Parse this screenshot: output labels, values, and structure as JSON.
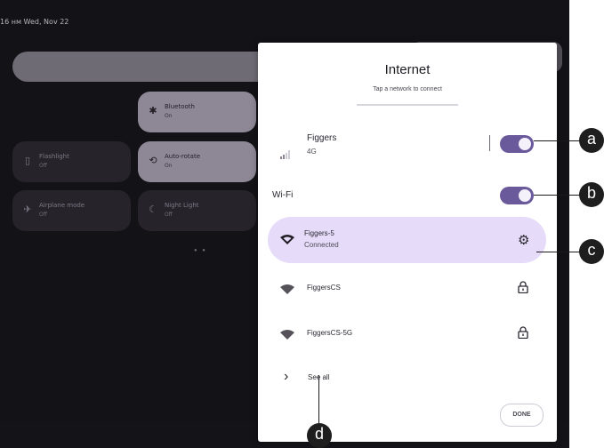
{
  "status_bar": {
    "clock": "16 нм Wed, Nov 22"
  },
  "quick_tiles": [
    {
      "name": "Bluetooth",
      "state": "On"
    },
    {
      "name": "Flashlight",
      "state": "Off"
    },
    {
      "name": "Auto-rotate",
      "state": "On"
    },
    {
      "name": "Airplane mode",
      "state": "Off"
    },
    {
      "name": "Night Light",
      "state": "Off"
    }
  ],
  "dialog": {
    "title": "Internet",
    "subtitle": "Tap a network to connect",
    "mobile": {
      "name": "Figgers",
      "type": "4G",
      "enabled": true
    },
    "wifi": {
      "label": "Wi-Fi",
      "enabled": true
    },
    "networks": [
      {
        "name": "Figgers-5",
        "status": "Connected",
        "icon": "settings-gear-icon"
      },
      {
        "name": "FiggersCS",
        "status": "",
        "icon": "lock-icon"
      },
      {
        "name": "FiggersCS-5G",
        "status": "",
        "icon": "lock-icon"
      }
    ],
    "see_all": "See all",
    "done": "DONE"
  },
  "annotations": [
    "a",
    "b",
    "c",
    "d"
  ],
  "colors": {
    "accent": "#6a5a9b",
    "card": "#e6dcf9",
    "scrim": "#131216"
  }
}
